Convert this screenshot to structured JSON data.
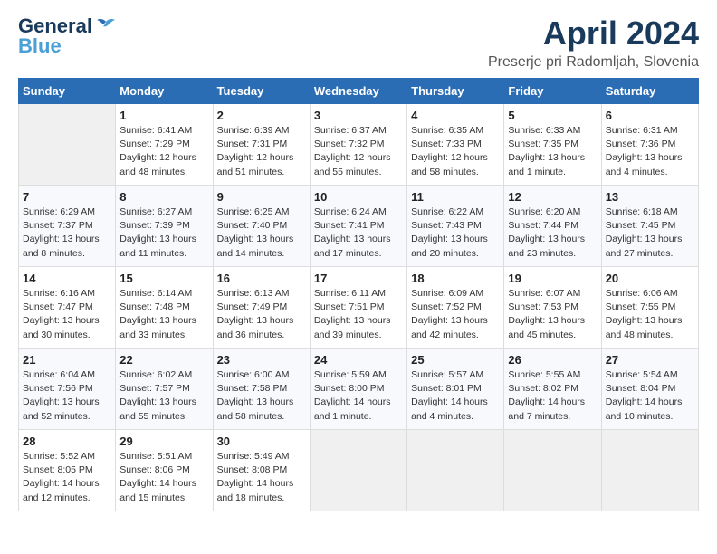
{
  "header": {
    "logo_general": "General",
    "logo_blue": "Blue",
    "month_title": "April 2024",
    "location": "Preserje pri Radomljah, Slovenia"
  },
  "weekdays": [
    "Sunday",
    "Monday",
    "Tuesday",
    "Wednesday",
    "Thursday",
    "Friday",
    "Saturday"
  ],
  "weeks": [
    [
      {
        "day": "",
        "info": ""
      },
      {
        "day": "1",
        "info": "Sunrise: 6:41 AM\nSunset: 7:29 PM\nDaylight: 12 hours\nand 48 minutes."
      },
      {
        "day": "2",
        "info": "Sunrise: 6:39 AM\nSunset: 7:31 PM\nDaylight: 12 hours\nand 51 minutes."
      },
      {
        "day": "3",
        "info": "Sunrise: 6:37 AM\nSunset: 7:32 PM\nDaylight: 12 hours\nand 55 minutes."
      },
      {
        "day": "4",
        "info": "Sunrise: 6:35 AM\nSunset: 7:33 PM\nDaylight: 12 hours\nand 58 minutes."
      },
      {
        "day": "5",
        "info": "Sunrise: 6:33 AM\nSunset: 7:35 PM\nDaylight: 13 hours\nand 1 minute."
      },
      {
        "day": "6",
        "info": "Sunrise: 6:31 AM\nSunset: 7:36 PM\nDaylight: 13 hours\nand 4 minutes."
      }
    ],
    [
      {
        "day": "7",
        "info": "Sunrise: 6:29 AM\nSunset: 7:37 PM\nDaylight: 13 hours\nand 8 minutes."
      },
      {
        "day": "8",
        "info": "Sunrise: 6:27 AM\nSunset: 7:39 PM\nDaylight: 13 hours\nand 11 minutes."
      },
      {
        "day": "9",
        "info": "Sunrise: 6:25 AM\nSunset: 7:40 PM\nDaylight: 13 hours\nand 14 minutes."
      },
      {
        "day": "10",
        "info": "Sunrise: 6:24 AM\nSunset: 7:41 PM\nDaylight: 13 hours\nand 17 minutes."
      },
      {
        "day": "11",
        "info": "Sunrise: 6:22 AM\nSunset: 7:43 PM\nDaylight: 13 hours\nand 20 minutes."
      },
      {
        "day": "12",
        "info": "Sunrise: 6:20 AM\nSunset: 7:44 PM\nDaylight: 13 hours\nand 23 minutes."
      },
      {
        "day": "13",
        "info": "Sunrise: 6:18 AM\nSunset: 7:45 PM\nDaylight: 13 hours\nand 27 minutes."
      }
    ],
    [
      {
        "day": "14",
        "info": "Sunrise: 6:16 AM\nSunset: 7:47 PM\nDaylight: 13 hours\nand 30 minutes."
      },
      {
        "day": "15",
        "info": "Sunrise: 6:14 AM\nSunset: 7:48 PM\nDaylight: 13 hours\nand 33 minutes."
      },
      {
        "day": "16",
        "info": "Sunrise: 6:13 AM\nSunset: 7:49 PM\nDaylight: 13 hours\nand 36 minutes."
      },
      {
        "day": "17",
        "info": "Sunrise: 6:11 AM\nSunset: 7:51 PM\nDaylight: 13 hours\nand 39 minutes."
      },
      {
        "day": "18",
        "info": "Sunrise: 6:09 AM\nSunset: 7:52 PM\nDaylight: 13 hours\nand 42 minutes."
      },
      {
        "day": "19",
        "info": "Sunrise: 6:07 AM\nSunset: 7:53 PM\nDaylight: 13 hours\nand 45 minutes."
      },
      {
        "day": "20",
        "info": "Sunrise: 6:06 AM\nSunset: 7:55 PM\nDaylight: 13 hours\nand 48 minutes."
      }
    ],
    [
      {
        "day": "21",
        "info": "Sunrise: 6:04 AM\nSunset: 7:56 PM\nDaylight: 13 hours\nand 52 minutes."
      },
      {
        "day": "22",
        "info": "Sunrise: 6:02 AM\nSunset: 7:57 PM\nDaylight: 13 hours\nand 55 minutes."
      },
      {
        "day": "23",
        "info": "Sunrise: 6:00 AM\nSunset: 7:58 PM\nDaylight: 13 hours\nand 58 minutes."
      },
      {
        "day": "24",
        "info": "Sunrise: 5:59 AM\nSunset: 8:00 PM\nDaylight: 14 hours\nand 1 minute."
      },
      {
        "day": "25",
        "info": "Sunrise: 5:57 AM\nSunset: 8:01 PM\nDaylight: 14 hours\nand 4 minutes."
      },
      {
        "day": "26",
        "info": "Sunrise: 5:55 AM\nSunset: 8:02 PM\nDaylight: 14 hours\nand 7 minutes."
      },
      {
        "day": "27",
        "info": "Sunrise: 5:54 AM\nSunset: 8:04 PM\nDaylight: 14 hours\nand 10 minutes."
      }
    ],
    [
      {
        "day": "28",
        "info": "Sunrise: 5:52 AM\nSunset: 8:05 PM\nDaylight: 14 hours\nand 12 minutes."
      },
      {
        "day": "29",
        "info": "Sunrise: 5:51 AM\nSunset: 8:06 PM\nDaylight: 14 hours\nand 15 minutes."
      },
      {
        "day": "30",
        "info": "Sunrise: 5:49 AM\nSunset: 8:08 PM\nDaylight: 14 hours\nand 18 minutes."
      },
      {
        "day": "",
        "info": ""
      },
      {
        "day": "",
        "info": ""
      },
      {
        "day": "",
        "info": ""
      },
      {
        "day": "",
        "info": ""
      }
    ]
  ]
}
